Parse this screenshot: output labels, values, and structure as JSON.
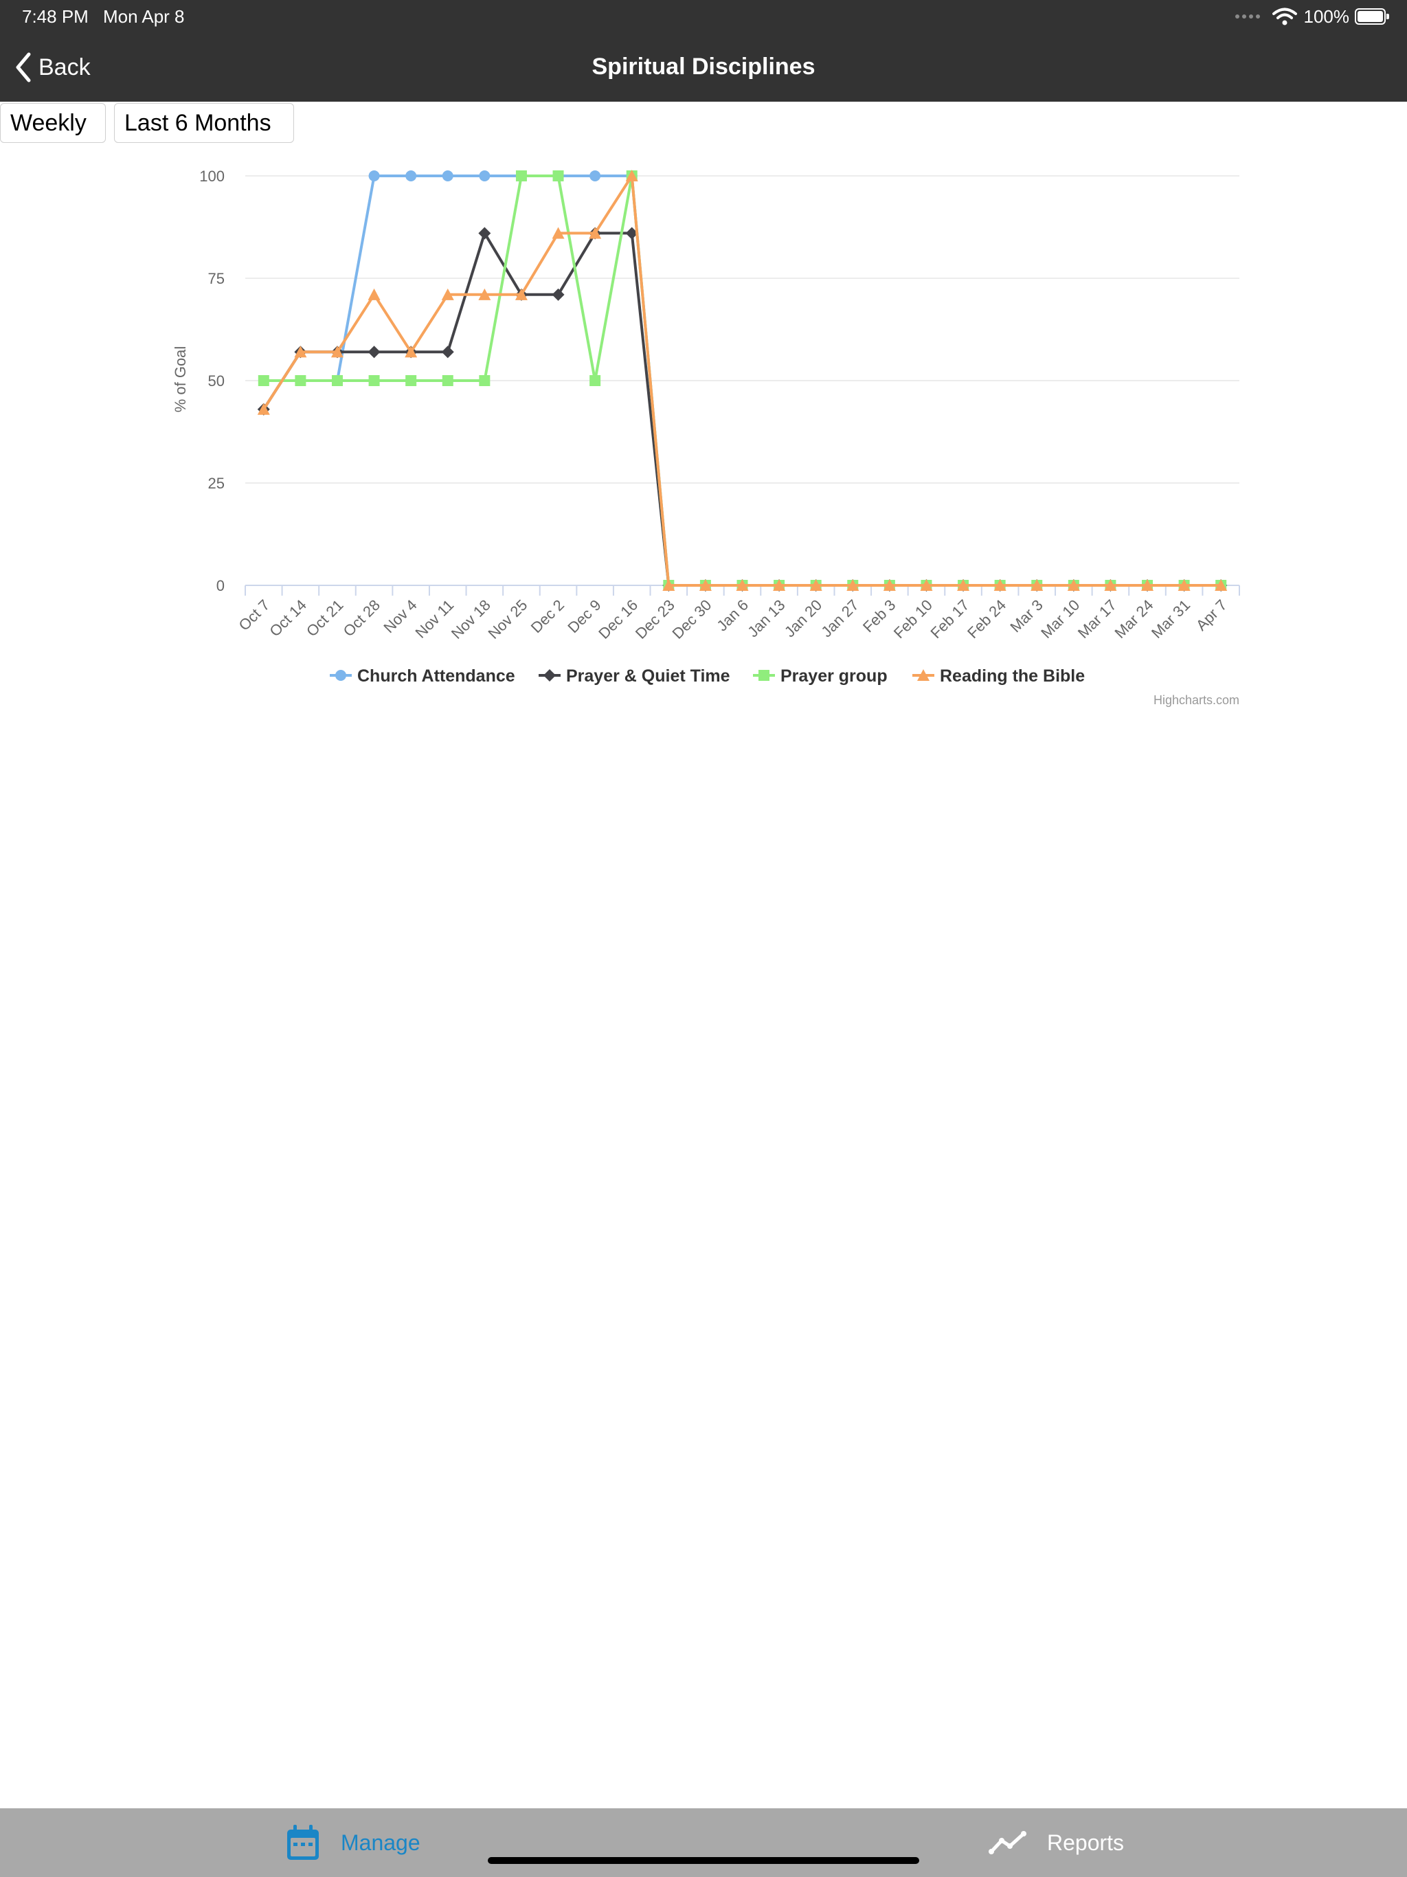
{
  "status_bar": {
    "time": "7:48 PM",
    "date": "Mon Apr 8",
    "battery": "100%"
  },
  "nav": {
    "back_label": "Back",
    "title": "Spiritual Disciplines"
  },
  "filters": {
    "period": "Weekly",
    "range": "Last 6 Months"
  },
  "chart_data": {
    "type": "line",
    "title": "",
    "xlabel": "",
    "ylabel": "% of Goal",
    "ylim": [
      0,
      100
    ],
    "yticks": [
      0,
      25,
      50,
      75,
      100
    ],
    "grid": true,
    "legend": "bottom-center",
    "categories": [
      "Oct 7",
      "Oct 14",
      "Oct 21",
      "Oct 28",
      "Nov 4",
      "Nov 11",
      "Nov 18",
      "Nov 25",
      "Dec 2",
      "Dec 9",
      "Dec 16",
      "Dec 23",
      "Dec 30",
      "Jan 6",
      "Jan 13",
      "Jan 20",
      "Jan 27",
      "Feb 3",
      "Feb 10",
      "Feb 17",
      "Feb 24",
      "Mar 3",
      "Mar 10",
      "Mar 17",
      "Mar 24",
      "Mar 31",
      "Apr 7"
    ],
    "series": [
      {
        "name": "Church Attendance",
        "color": "#7cb5ec",
        "marker": "circle",
        "values": [
          null,
          null,
          50,
          100,
          100,
          100,
          100,
          100,
          100,
          100,
          100,
          0,
          0,
          0,
          0,
          0,
          0,
          0,
          0,
          0,
          0,
          0,
          0,
          0,
          0,
          0,
          0
        ]
      },
      {
        "name": "Prayer & Quiet Time",
        "color": "#434348",
        "marker": "diamond",
        "values": [
          43,
          57,
          57,
          57,
          57,
          57,
          86,
          71,
          71,
          86,
          86,
          0,
          0,
          0,
          0,
          0,
          0,
          0,
          0,
          0,
          0,
          0,
          0,
          0,
          0,
          0,
          0
        ]
      },
      {
        "name": "Prayer group",
        "color": "#90ed7d",
        "marker": "square",
        "values": [
          50,
          50,
          50,
          50,
          50,
          50,
          50,
          100,
          100,
          50,
          100,
          0,
          0,
          0,
          0,
          0,
          0,
          0,
          0,
          0,
          0,
          0,
          0,
          0,
          0,
          0,
          0
        ]
      },
      {
        "name": "Reading the Bible",
        "color": "#f7a35c",
        "marker": "triangle",
        "values": [
          43,
          57,
          57,
          71,
          57,
          71,
          71,
          71,
          86,
          86,
          100,
          0,
          0,
          0,
          0,
          0,
          0,
          0,
          0,
          0,
          0,
          0,
          0,
          0,
          0,
          0,
          0
        ]
      }
    ],
    "credits": "Highcharts.com"
  },
  "tabs": [
    {
      "label": "Manage",
      "icon": "calendar-icon",
      "active": true,
      "color": "#1a86c6"
    },
    {
      "label": "Reports",
      "icon": "chart-line-icon",
      "active": false,
      "color": "#ffffff"
    }
  ]
}
